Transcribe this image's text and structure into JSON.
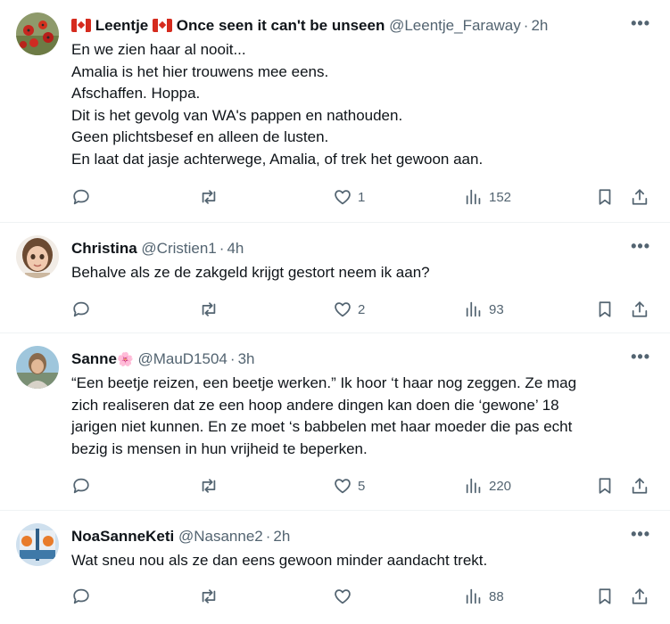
{
  "tweets": [
    {
      "name": "Leentje",
      "name_suffix": "Once seen it can't be unseen",
      "handle": "@Leentje_Faraway",
      "time": "2h",
      "lines": [
        "En we zien haar al nooit...",
        "Amalia is het hier trouwens mee eens.",
        "Afschaffen. Hoppa.",
        "Dit is het gevolg van WA's pappen en nathouden.",
        "Geen plichtsbesef en alleen de lusten.",
        "En laat dat jasje achterwege, Amalia, of trek het gewoon aan."
      ],
      "likes": "1",
      "views": "152"
    },
    {
      "name": "Christina",
      "handle": "@Cristien1",
      "time": "4h",
      "lines": [
        "Behalve als ze de zakgeld krijgt gestort neem ik aan?"
      ],
      "likes": "2",
      "views": "93"
    },
    {
      "name": "Sanne",
      "name_emoji": "🌸",
      "handle": "@MauD1504",
      "time": "3h",
      "lines": [
        "“Een beetje reizen, een beetje werken.” Ik hoor ‘t haar nog zeggen. Ze mag",
        "zich realiseren dat ze een hoop andere dingen kan doen die ‘gewone’ 18",
        "jarigen niet kunnen. En ze moet ‘s babbelen met haar moeder die pas echt",
        "bezig is mensen in hun vrijheid te beperken."
      ],
      "likes": "5",
      "views": "220"
    },
    {
      "name": "NoaSanneKeti",
      "handle": "@Nasanne2",
      "time": "2h",
      "lines": [
        "Wat sneu nou als ze dan eens gewoon minder aandacht trekt."
      ],
      "likes": "",
      "views": "88"
    }
  ],
  "ui": {
    "dot": "·",
    "more": "•••"
  },
  "colors": {
    "text": "#0f1419",
    "muted": "#536471",
    "divider": "#eff3f4"
  }
}
